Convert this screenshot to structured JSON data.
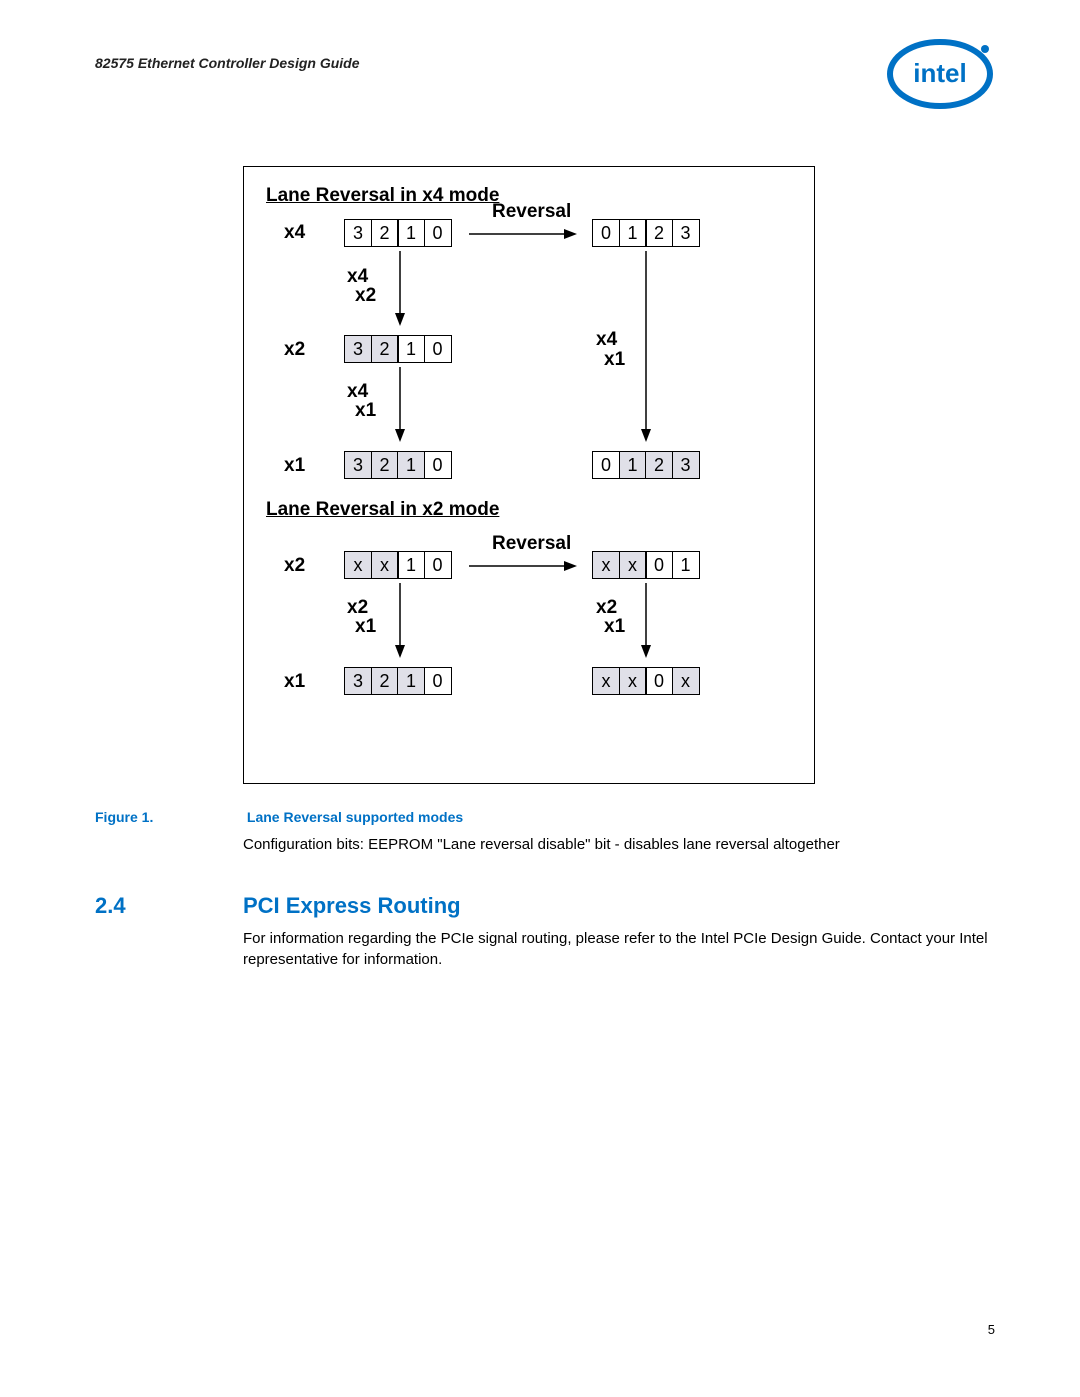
{
  "header": {
    "doc_title": "82575 Ethernet Controller Design Guide"
  },
  "figure": {
    "section_x4_title": "Lane Reversal in x4 mode",
    "section_x2_title": "Lane Reversal in x2 mode",
    "reversal_label": "Reversal",
    "labels": {
      "x4": "x4",
      "x2": "x2",
      "x1": "x1",
      "x4_x2_a": "x4",
      "x4_x2_b": "x2",
      "x4_x1_a": "x4",
      "x4_x1_b": "x1",
      "x4_x1_ra": "x4",
      "x4_x1_rb": "x1",
      "x2_x1_a": "x2",
      "x2_x1_b": "x1",
      "x2_x1_ra": "x2",
      "x2_x1_rb": "x1"
    },
    "rows": {
      "x4_left": {
        "c0": "3",
        "c1": "2",
        "c2": "1",
        "c3": "0"
      },
      "x4_right": {
        "c0": "0",
        "c1": "1",
        "c2": "2",
        "c3": "3"
      },
      "x2_left": {
        "c0": "3",
        "c1": "2",
        "c2": "1",
        "c3": "0"
      },
      "x1_left": {
        "c0": "3",
        "c1": "2",
        "c2": "1",
        "c3": "0"
      },
      "x1_right": {
        "c0": "0",
        "c1": "1",
        "c2": "2",
        "c3": "3"
      },
      "mx2_left": {
        "c0": "x",
        "c1": "x",
        "c2": "1",
        "c3": "0"
      },
      "mx2_right": {
        "c0": "x",
        "c1": "x",
        "c2": "0",
        "c3": "1"
      },
      "mx1_left": {
        "c0": "3",
        "c1": "2",
        "c2": "1",
        "c3": "0"
      },
      "mx1_right": {
        "c0": "x",
        "c1": "x",
        "c2": "0",
        "c3": "x"
      }
    }
  },
  "caption": {
    "label": "Figure 1.",
    "text": "Lane Reversal supported modes"
  },
  "config_text": "Configuration bits: EEPROM \"Lane reversal disable\" bit - disables lane reversal altogether",
  "section": {
    "number": "2.4",
    "title": "PCI Express Routing",
    "body": "For information regarding the PCIe signal routing, please refer to the Intel PCIe Design Guide. Contact your Intel representative for information."
  },
  "page_number": "5"
}
